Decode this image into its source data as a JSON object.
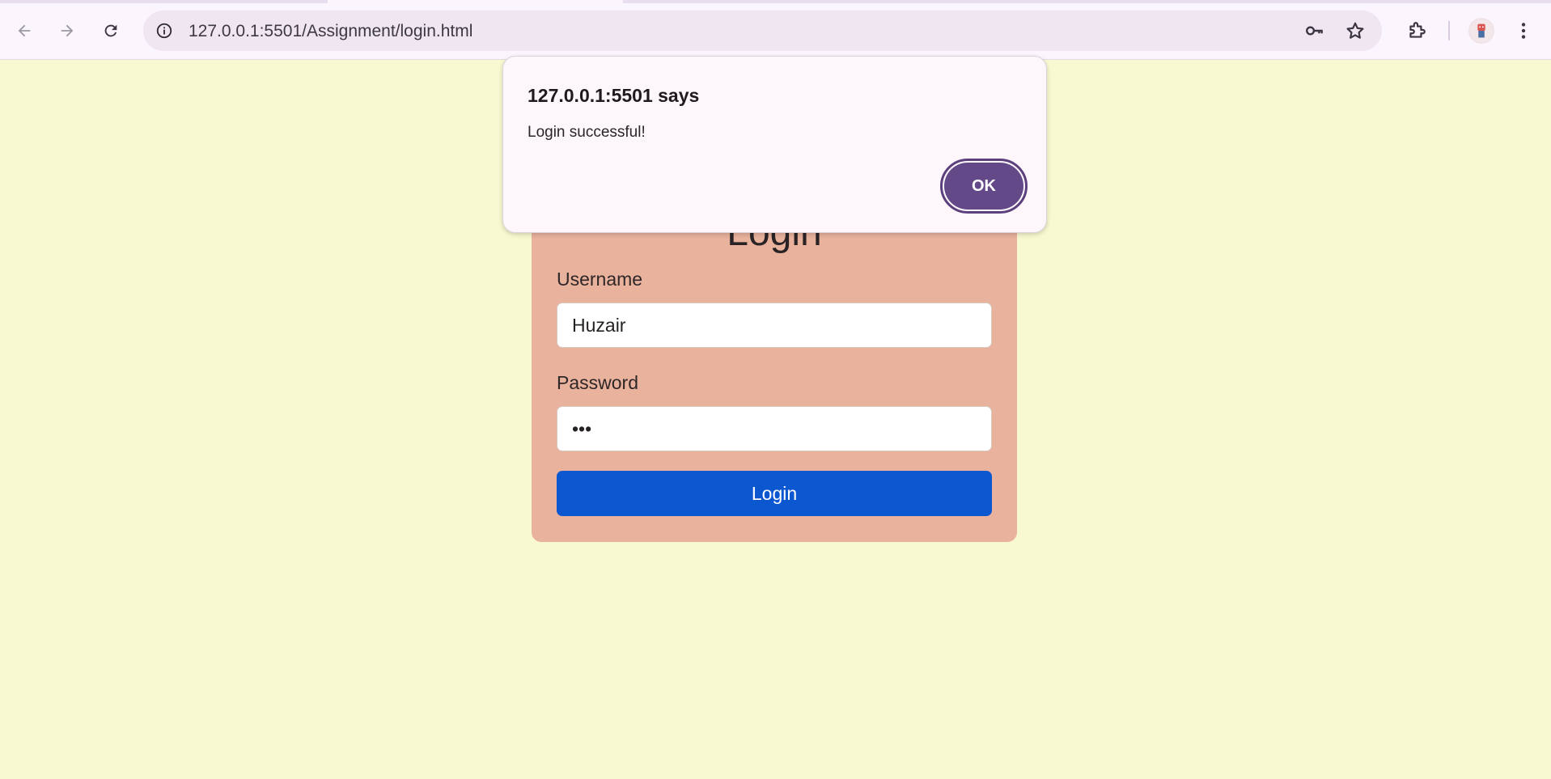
{
  "browser": {
    "url": "127.0.0.1:5501/Assignment/login.html",
    "icons": {
      "back": "arrow-left-icon",
      "forward": "arrow-right-icon",
      "reload": "reload-icon",
      "site_info": "info-icon",
      "password_manager": "key-icon",
      "bookmark": "star-icon",
      "extensions": "puzzle-icon",
      "profile": "avatar",
      "menu": "kebab-menu-icon"
    }
  },
  "login": {
    "title": "Login",
    "username_label": "Username",
    "username_value": "Huzair",
    "password_label": "Password",
    "password_value": "•••",
    "submit_label": "Login"
  },
  "dialog": {
    "title": "127.0.0.1:5501 says",
    "message": "Login successful!",
    "ok_label": "OK"
  },
  "colors": {
    "page_background": "#f8f9d0",
    "card_background": "#e9b29d",
    "login_button": "#0b57d0",
    "ok_button": "#634988"
  }
}
